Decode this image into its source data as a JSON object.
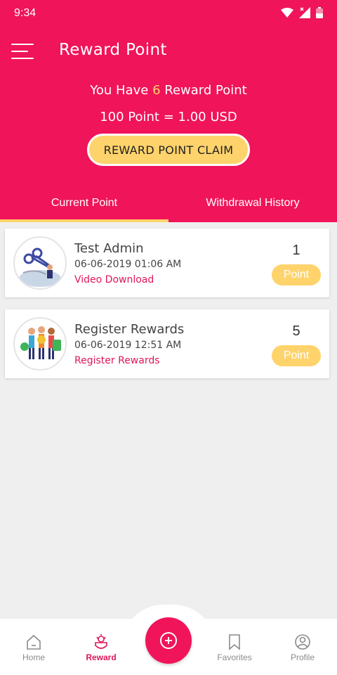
{
  "status_bar": {
    "time": "9:34"
  },
  "header": {
    "title": "Reward Point"
  },
  "summary": {
    "prefix": "You Have",
    "count": "6",
    "suffix": "Reward Point",
    "rate": "100 Point = 1.00 USD",
    "claim_label": "REWARD POINT CLAIM"
  },
  "tabs": [
    {
      "label": "Current Point",
      "active": true
    },
    {
      "label": "Withdrawal History",
      "active": false
    }
  ],
  "rewards": [
    {
      "title": "Test Admin",
      "date": "06-06-2019 01:06 AM",
      "type": "Video Download",
      "points": "1",
      "badge": "Point",
      "icon": "scissors-worker-icon"
    },
    {
      "title": "Register Rewards",
      "date": "06-06-2019 12:51 AM",
      "type": "Register Rewards",
      "points": "5",
      "badge": "Point",
      "icon": "people-money-icon"
    }
  ],
  "bottom_nav": [
    {
      "label": "Home",
      "icon": "home-icon"
    },
    {
      "label": "Reward",
      "icon": "reward-icon",
      "active": true
    },
    {
      "label": "Favorites",
      "icon": "bookmark-icon"
    },
    {
      "label": "Profile",
      "icon": "profile-icon"
    }
  ],
  "colors": {
    "primary": "#f0145a",
    "accent": "#ffd36b",
    "background": "#efefef"
  }
}
